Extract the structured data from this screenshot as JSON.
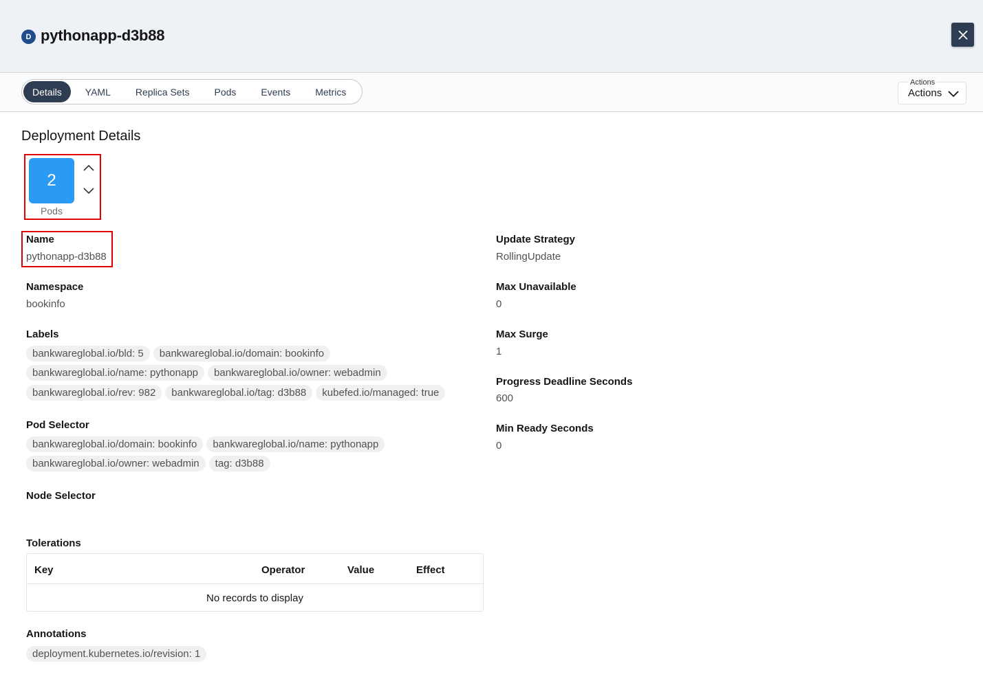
{
  "header": {
    "kind_badge": "D",
    "title": "pythonapp-d3b88",
    "close_icon": "close-icon"
  },
  "tabs": [
    {
      "label": "Details",
      "active": true
    },
    {
      "label": "YAML",
      "active": false
    },
    {
      "label": "Replica Sets",
      "active": false
    },
    {
      "label": "Pods",
      "active": false
    },
    {
      "label": "Events",
      "active": false
    },
    {
      "label": "Metrics",
      "active": false
    }
  ],
  "actions": {
    "floating_label": "Actions",
    "label": "Actions",
    "icon": "chevron-down-icon"
  },
  "details": {
    "section_title": "Deployment Details",
    "pods": {
      "count": "2",
      "label": "Pods"
    },
    "name": {
      "label": "Name",
      "value": "pythonapp-d3b88"
    },
    "namespace": {
      "label": "Namespace",
      "value": "bookinfo"
    },
    "labels": {
      "label": "Labels",
      "rows": [
        [
          "bankwareglobal.io/bld: 5",
          "bankwareglobal.io/domain: bookinfo"
        ],
        [
          "bankwareglobal.io/name: pythonapp",
          "bankwareglobal.io/owner: webadmin"
        ],
        [
          "bankwareglobal.io/rev: 982",
          "bankwareglobal.io/tag: d3b88",
          "kubefed.io/managed: true"
        ]
      ]
    },
    "pod_selector": {
      "label": "Pod Selector",
      "rows": [
        [
          "bankwareglobal.io/domain: bookinfo",
          "bankwareglobal.io/name: pythonapp"
        ],
        [
          "bankwareglobal.io/owner: webadmin",
          "tag: d3b88"
        ]
      ]
    },
    "node_selector": {
      "label": "Node Selector"
    },
    "tolerations": {
      "label": "Tolerations",
      "columns": [
        "Key",
        "Operator",
        "Value",
        "Effect"
      ],
      "empty_message": "No records to display"
    },
    "annotations": {
      "label": "Annotations",
      "items": [
        "deployment.kubernetes.io/revision: 1"
      ]
    },
    "update_strategy": {
      "label": "Update Strategy",
      "value": "RollingUpdate"
    },
    "max_unavailable": {
      "label": "Max Unavailable",
      "value": "0"
    },
    "max_surge": {
      "label": "Max Surge",
      "value": "1"
    },
    "progress_deadline": {
      "label": "Progress Deadline Seconds",
      "value": "600"
    },
    "min_ready": {
      "label": "Min Ready Seconds",
      "value": "0"
    }
  },
  "colors": {
    "header_bg": "#eef2f7",
    "active_tab": "#2e3d52",
    "pod_tile": "#2b9af3",
    "highlight": "#e00000"
  }
}
